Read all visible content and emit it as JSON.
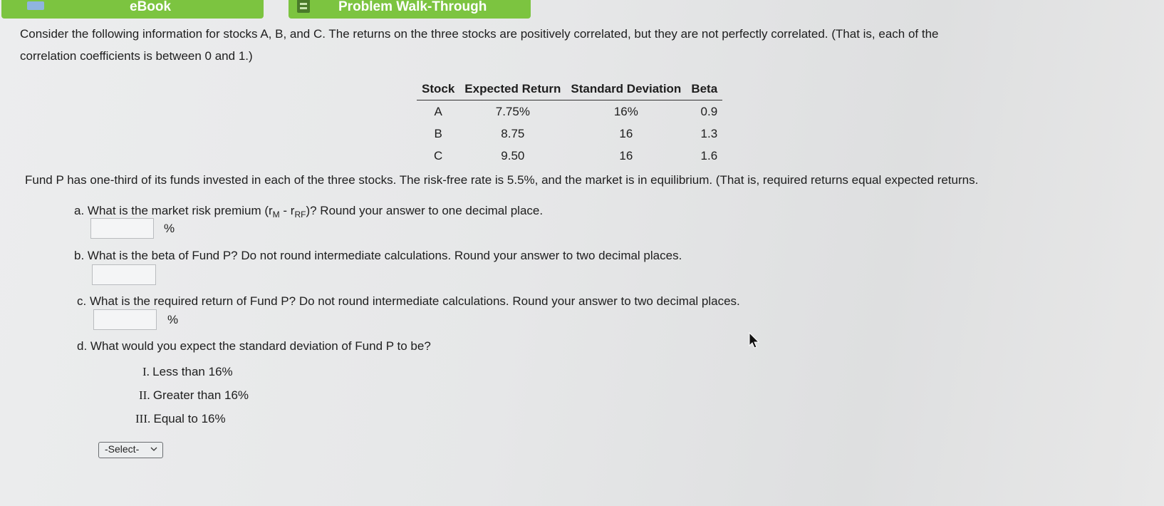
{
  "topbar": {
    "ebook_label": "eBook",
    "walkthrough_label": "Problem Walk-Through"
  },
  "intro": {
    "line1": "Consider the following information for stocks A, B, and C. The returns on the three stocks are positively correlated, but they are not perfectly correlated. (That is, each of the",
    "line2": "correlation coefficients is between 0 and 1.)"
  },
  "table": {
    "headers": [
      "Stock",
      "Expected Return",
      "Standard Deviation",
      "Beta"
    ],
    "rows": [
      [
        "A",
        "7.75%",
        "16%",
        "0.9"
      ],
      [
        "B",
        "8.75",
        "16",
        "1.3"
      ],
      [
        "C",
        "9.50",
        "16",
        "1.6"
      ]
    ]
  },
  "fund_text": "Fund P has one-third of its funds invested in each of the three stocks. The risk-free rate is 5.5%, and the market is in equilibrium. (That is, required returns equal expected returns.",
  "questions": {
    "a_prefix": "a. What is the market risk premium (r",
    "a_sub_m": "M",
    "a_dash": " - r",
    "a_sub_rf": "RF",
    "a_suffix": ")? Round your answer to one decimal place.",
    "a_unit": "%",
    "b": "b. What is the beta of Fund P? Do not round intermediate calculations. Round your answer to two decimal places.",
    "c": "c. What is the required return of Fund P? Do not round intermediate calculations. Round your answer to two decimal places.",
    "c_unit": "%",
    "d": "d. What would you expect the standard deviation of Fund P to be?"
  },
  "options": [
    {
      "numeral": "I.",
      "text": "Less than 16%"
    },
    {
      "numeral": "II.",
      "text": "Greater than 16%"
    },
    {
      "numeral": "III.",
      "text": "Equal to 16%"
    }
  ],
  "select": {
    "value": "-Select-"
  }
}
